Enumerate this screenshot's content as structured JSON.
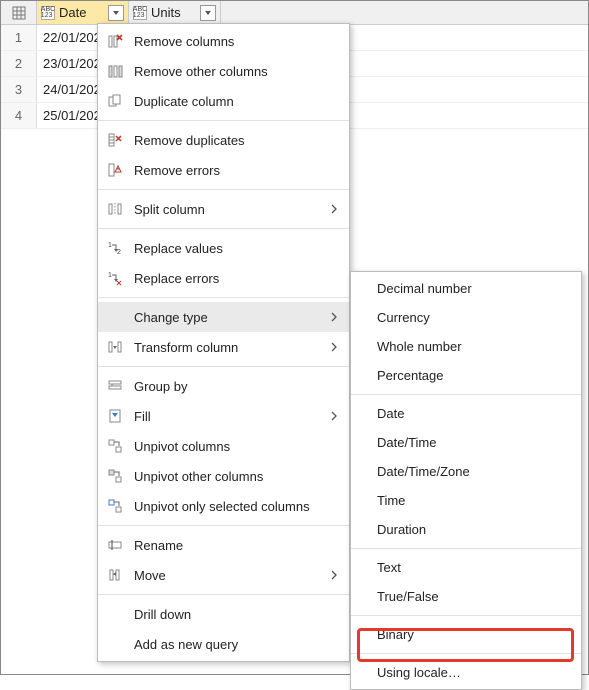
{
  "columns": {
    "col1": {
      "label": "Date",
      "type_icon": "abc-123"
    },
    "col2": {
      "label": "Units",
      "type_icon": "abc-123"
    }
  },
  "rows": [
    {
      "n": "1",
      "date": "22/01/202"
    },
    {
      "n": "2",
      "date": "23/01/202"
    },
    {
      "n": "3",
      "date": "24/01/202"
    },
    {
      "n": "4",
      "date": "25/01/202"
    }
  ],
  "menu": {
    "remove_columns": "Remove columns",
    "remove_other_columns": "Remove other columns",
    "duplicate_column": "Duplicate column",
    "remove_duplicates": "Remove duplicates",
    "remove_errors": "Remove errors",
    "split_column": "Split column",
    "replace_values": "Replace values",
    "replace_errors": "Replace errors",
    "change_type": "Change type",
    "transform_column": "Transform column",
    "group_by": "Group by",
    "fill": "Fill",
    "unpivot_columns": "Unpivot columns",
    "unpivot_other_columns": "Unpivot other columns",
    "unpivot_only_selected": "Unpivot only selected columns",
    "rename": "Rename",
    "move": "Move",
    "drill_down": "Drill down",
    "add_as_new_query": "Add as new query"
  },
  "submenu": {
    "decimal_number": "Decimal number",
    "currency": "Currency",
    "whole_number": "Whole number",
    "percentage": "Percentage",
    "date": "Date",
    "date_time": "Date/Time",
    "date_time_zone": "Date/Time/Zone",
    "time": "Time",
    "duration": "Duration",
    "text": "Text",
    "true_false": "True/False",
    "binary": "Binary",
    "using_locale": "Using locale…"
  }
}
